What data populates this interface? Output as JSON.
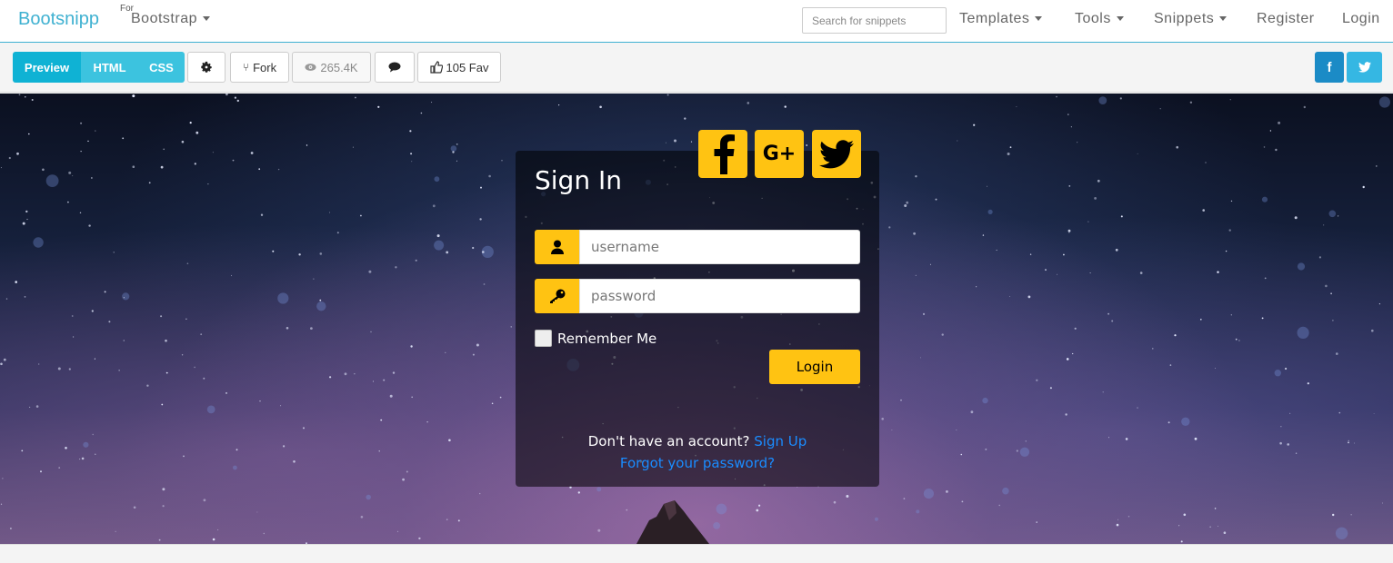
{
  "navbar": {
    "brand": "Bootsnipp",
    "for_label": "For",
    "framework": "Bootstrap",
    "search_placeholder": "Search for snippets",
    "items": [
      {
        "label": "Templates",
        "dropdown": true
      },
      {
        "label": "Tools",
        "dropdown": true
      },
      {
        "label": "Snippets",
        "dropdown": true
      },
      {
        "label": "Register",
        "dropdown": false
      },
      {
        "label": "Login",
        "dropdown": false
      }
    ],
    "accent_color": "#3fb1d1"
  },
  "toolbar": {
    "tabs": [
      "Preview",
      "HTML",
      "CSS"
    ],
    "active_tab": "Preview",
    "fork_label": "Fork",
    "views_label": "265.4K",
    "fav_label": "105 Fav",
    "share_facebook": "f",
    "icons": [
      "gear-icon",
      "fork-icon",
      "eye-icon",
      "comment-icon",
      "thumbs-up-icon",
      "facebook-icon",
      "twitter-icon"
    ]
  },
  "signin": {
    "title": "Sign In",
    "username_placeholder": "username",
    "password_placeholder": "password",
    "remember_label": "Remember Me",
    "login_label": "Login",
    "no_account_text": "Don't have an account?",
    "signup_link": "Sign Up",
    "forgot_link": "Forgot your password?",
    "social_icons": [
      "facebook-icon",
      "google-plus-icon",
      "twitter-icon"
    ],
    "google_plus_text": "G+",
    "accent_color": "#ffc312",
    "link_color": "#1a8cff"
  }
}
